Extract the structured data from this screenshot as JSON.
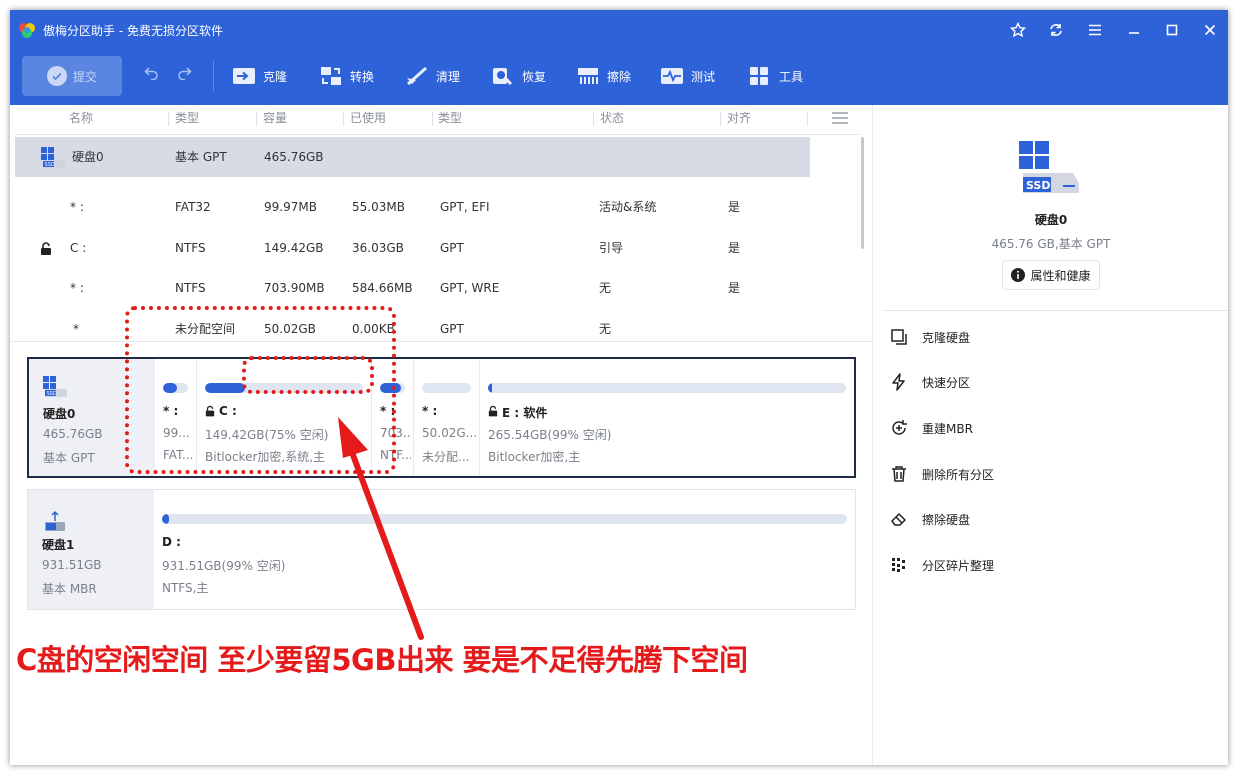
{
  "app": {
    "title": "傲梅分区助手 - 免费无损分区软件"
  },
  "toolbar": {
    "submit_label": "提交",
    "items": [
      {
        "label": "克隆",
        "icon": "clone-icon"
      },
      {
        "label": "转换",
        "icon": "convert-icon"
      },
      {
        "label": "清理",
        "icon": "cleanup-icon"
      },
      {
        "label": "恢复",
        "icon": "recover-icon"
      },
      {
        "label": "擦除",
        "icon": "wipe-icon"
      },
      {
        "label": "测试",
        "icon": "test-icon"
      },
      {
        "label": "工具",
        "icon": "tools-icon"
      }
    ]
  },
  "list": {
    "columns": [
      "名称",
      "类型",
      "容量",
      "已使用",
      "类型",
      "状态",
      "对齐"
    ],
    "disk_row": {
      "name": "硬盘0",
      "type": "基本 GPT",
      "capacity": "465.76GB"
    },
    "rows": [
      {
        "name": "* :",
        "fs": "FAT32",
        "capacity": "99.97MB",
        "used": "55.03MB",
        "ptype": "GPT, EFI",
        "status": "活动&系统",
        "align": "是",
        "locked": false
      },
      {
        "name": "C :",
        "fs": "NTFS",
        "capacity": "149.42GB",
        "used": "36.03GB",
        "ptype": "GPT",
        "status": "引导",
        "align": "是",
        "locked": true
      },
      {
        "name": "* :",
        "fs": "NTFS",
        "capacity": "703.90MB",
        "used": "584.66MB",
        "ptype": "GPT, WRE",
        "status": "无",
        "align": "是",
        "locked": false
      },
      {
        "name": "*",
        "fs": "未分配空间",
        "capacity": "50.02GB",
        "used": "0.00KB",
        "ptype": "GPT",
        "status": "无",
        "align": "",
        "locked": false
      }
    ]
  },
  "disk_map": {
    "disk0": {
      "name": "硬盘0",
      "size": "465.76GB",
      "type": "基本 GPT",
      "partitions": [
        {
          "name": "* :",
          "size": "99...",
          "type": "FAT...",
          "used_fraction": 0.55
        },
        {
          "name": "C :",
          "size": "149.42GB(75% 空闲)",
          "type": "Bitlocker加密,系统,主",
          "used_fraction": 0.25
        },
        {
          "name": "* :",
          "size": "703...",
          "type": "NTF...",
          "used_fraction": 0.83
        },
        {
          "name": "* :",
          "size": "50.02G...",
          "type": "未分配...",
          "used_fraction": 0
        },
        {
          "name": "E : 软件",
          "size": "265.54GB(99% 空闲)",
          "type": "Bitlocker加密,主",
          "used_fraction": 0.01
        }
      ]
    },
    "disk1": {
      "name": "硬盘1",
      "size": "931.51GB",
      "type": "基本 MBR",
      "partitions": [
        {
          "name": "D :",
          "size": "931.51GB(99% 空闲)",
          "type": "NTFS,主",
          "used_fraction": 0.01
        }
      ]
    }
  },
  "right_panel": {
    "disk_name": "硬盘0",
    "disk_sub": "465.76 GB,基本 GPT",
    "props_button": "属性和健康",
    "actions": [
      "克隆硬盘",
      "快速分区",
      "重建MBR",
      "删除所有分区",
      "擦除硬盘",
      "分区碎片整理"
    ]
  },
  "annotation": {
    "text": "C盘的空闲空间 至少要留5GB出来 要是不足得先腾下空间"
  },
  "colors": {
    "accent": "#2e62d8",
    "annotation": "#e51b1b"
  }
}
